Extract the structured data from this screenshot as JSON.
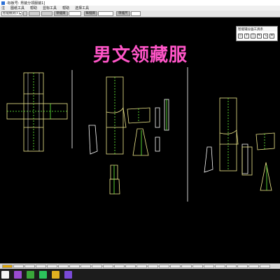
{
  "window": {
    "title": "-标板号: 男装分领服装1]"
  },
  "menu": {
    "items": [
      "注",
      "图纸工具",
      "帮助",
      "显标工具",
      "帮助",
      "选择工具"
    ]
  },
  "toolbar": {
    "mode_select": "智能模式(F)",
    "label_1": "单缝目",
    "label_2": "纵缝目",
    "label_3": "单缝尺"
  },
  "watermark": {
    "text": "男文领藏服"
  },
  "smart_panel": {
    "title": "智能辅分画工具条",
    "tools": [
      "select-tool-icon",
      "text-tool-icon",
      "line-tool-icon",
      "pen-tool-icon",
      "arrow-tool-icon",
      "cross-tool-icon",
      "ruler-tool-icon"
    ]
  },
  "colors": {
    "pattern_outline": "#ffffff",
    "pattern_fill": "#f0e98c",
    "seam_line": "#6bff3b",
    "accent_watermark": "#ff55c8",
    "divider": "#cfcfcf"
  },
  "taskbar": {
    "apps": [
      {
        "icon": "start-icon",
        "color": "#f3f3f3"
      },
      {
        "icon": "app-purple-icon",
        "color": "#9a4bd0"
      },
      {
        "icon": "app-green-icon",
        "color": "#3aa63a"
      },
      {
        "icon": "wechat-icon",
        "color": "#2cc25c"
      },
      {
        "icon": "app-yellow-icon",
        "color": "#e0b020"
      },
      {
        "icon": "app-cad-icon",
        "color": "#7a4ad8"
      }
    ]
  }
}
